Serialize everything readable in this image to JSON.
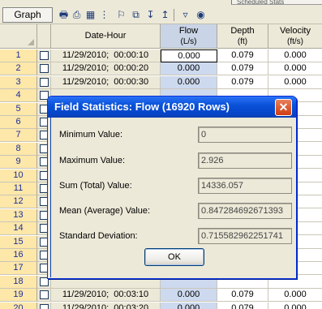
{
  "toolbar": {
    "graph_label": "Graph",
    "icons": [
      "print-preview-icon",
      "print-icon",
      "table-icon",
      "columns-icon",
      "find-icon",
      "copy-icon",
      "import-icon",
      "export-icon",
      "filter-icon",
      "binoculars-icon"
    ],
    "top_strip_text": "Scheduled Stats"
  },
  "grid": {
    "headers": {
      "date": "Date-Hour",
      "flow": "Flow",
      "flow_unit": "(L/s)",
      "depth": "Depth",
      "depth_unit": "(ft)",
      "velocity": "Velocity",
      "velocity_unit": "(ft/s)"
    },
    "rows": [
      {
        "n": "1",
        "date": "11/29/2010;  00:00:10",
        "flow": "0.000",
        "depth": "0.079",
        "vel": "0.000"
      },
      {
        "n": "2",
        "date": "11/29/2010;  00:00:20",
        "flow": "0.000",
        "depth": "0.079",
        "vel": "0.000"
      },
      {
        "n": "3",
        "date": "11/29/2010;  00:00:30",
        "flow": "0.000",
        "depth": "0.079",
        "vel": "0.000"
      },
      {
        "n": "4",
        "date": "",
        "flow": "",
        "depth": "",
        "vel": ""
      },
      {
        "n": "5",
        "date": "",
        "flow": "",
        "depth": "",
        "vel": ""
      },
      {
        "n": "6",
        "date": "",
        "flow": "",
        "depth": "",
        "vel": ""
      },
      {
        "n": "7",
        "date": "",
        "flow": "",
        "depth": "",
        "vel": ""
      },
      {
        "n": "8",
        "date": "",
        "flow": "",
        "depth": "",
        "vel": ""
      },
      {
        "n": "9",
        "date": "",
        "flow": "",
        "depth": "",
        "vel": ""
      },
      {
        "n": "10",
        "date": "",
        "flow": "",
        "depth": "",
        "vel": ""
      },
      {
        "n": "11",
        "date": "",
        "flow": "",
        "depth": "",
        "vel": ""
      },
      {
        "n": "12",
        "date": "",
        "flow": "",
        "depth": "",
        "vel": ""
      },
      {
        "n": "13",
        "date": "",
        "flow": "",
        "depth": "",
        "vel": ""
      },
      {
        "n": "14",
        "date": "",
        "flow": "",
        "depth": "",
        "vel": ""
      },
      {
        "n": "15",
        "date": "",
        "flow": "",
        "depth": "",
        "vel": ""
      },
      {
        "n": "16",
        "date": "",
        "flow": "",
        "depth": "",
        "vel": ""
      },
      {
        "n": "17",
        "date": "",
        "flow": "",
        "depth": "",
        "vel": ""
      },
      {
        "n": "18",
        "date": "",
        "flow": "",
        "depth": "",
        "vel": ""
      },
      {
        "n": "19",
        "date": "11/29/2010;  00:03:10",
        "flow": "0.000",
        "depth": "0.079",
        "vel": "0.000"
      },
      {
        "n": "20",
        "date": "11/29/2010;  00:03:20",
        "flow": "0.000",
        "depth": "0.079",
        "vel": "0.000"
      }
    ]
  },
  "dialog": {
    "title": "Field Statistics: Flow (16920 Rows)",
    "fields": [
      {
        "label": "Minimum Value:",
        "value": "0"
      },
      {
        "label": "Maximum Value:",
        "value": "2.926"
      },
      {
        "label": "Sum (Total) Value:",
        "value": "14336.057"
      },
      {
        "label": "Mean (Average) Value:",
        "value": "0.847284692671393"
      },
      {
        "label": "Standard Deviation:",
        "value": "0.715582962251741"
      }
    ],
    "ok_label": "OK"
  },
  "colors": {
    "row_number_bg": "#fde7a9",
    "flow_column_bg": "#cdd9ee",
    "titlebar_blue": "#0a52d9",
    "close_red": "#cf3c12"
  }
}
